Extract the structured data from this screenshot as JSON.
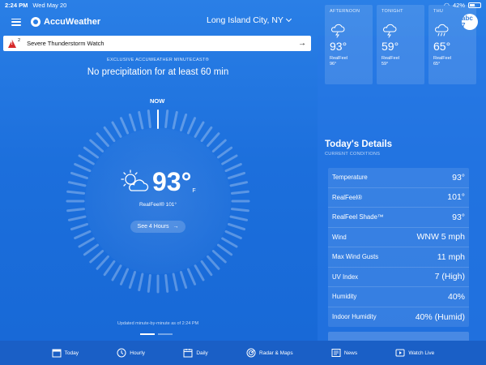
{
  "status_bar": {
    "time": "2:24 PM",
    "date": "Wed May 20",
    "battery": "42%"
  },
  "header": {
    "brand": "AccuWeather",
    "location": "Long Island City, NY",
    "partner_logo_text": "abc 7"
  },
  "alert": {
    "count": "2",
    "text": "Severe Thunderstorm Watch",
    "arrow": "→"
  },
  "minutecast": {
    "kicker": "EXCLUSIVE ACCUWEATHER MINUTECAST®",
    "summary": "No precipitation for at least 60 min",
    "now_label": "NOW",
    "updated": "Updated minute-by-minute as of 2:24 PM"
  },
  "current": {
    "temp": "93°",
    "unit": "F",
    "realfeel": "RealFeel® 101°",
    "see_hours_label": "See 4 Hours",
    "icon": "partly-sunny-icon"
  },
  "forecast_cards": [
    {
      "label": "AFTERNOON",
      "temp": "93°",
      "realfeel_label": "RealFeel",
      "realfeel": "96°",
      "icon": "thunderstorm-icon"
    },
    {
      "label": "TONIGHT",
      "temp": "59°",
      "realfeel_label": "RealFeel",
      "realfeel": "59°",
      "icon": "thunderstorm-icon"
    },
    {
      "label": "THU",
      "temp": "65°",
      "realfeel_label": "RealFeel",
      "realfeel": "65°",
      "icon": "showers-icon"
    }
  ],
  "todays_details": {
    "title": "Today's Details",
    "subtitle": "CURRENT CONDITIONS",
    "rows": [
      {
        "label": "Temperature",
        "value": "93°"
      },
      {
        "label": "RealFeel®",
        "value": "101°"
      },
      {
        "label": "RealFeel Shade™",
        "value": "93°"
      },
      {
        "label": "Wind",
        "value": "WNW 5 mph"
      },
      {
        "label": "Max Wind Gusts",
        "value": "11 mph"
      },
      {
        "label": "UV Index",
        "value": "7 (High)"
      },
      {
        "label": "Humidity",
        "value": "40%"
      },
      {
        "label": "Indoor Humidity",
        "value": "40% (Humid)"
      }
    ]
  },
  "tabs": [
    {
      "label": "Today",
      "icon": "calendar-today-icon",
      "active": true
    },
    {
      "label": "Hourly",
      "icon": "clock-icon",
      "active": false
    },
    {
      "label": "Daily",
      "icon": "calendar-icon",
      "active": false
    },
    {
      "label": "Radar & Maps",
      "icon": "radar-icon",
      "active": false
    },
    {
      "label": "News",
      "icon": "news-icon",
      "active": false
    },
    {
      "label": "Watch Live",
      "icon": "play-icon",
      "active": false
    }
  ],
  "colors": {
    "background": "#1e6fd6",
    "tab_bar": "#1a5fc6",
    "alert_icon": "#d62a2a"
  }
}
